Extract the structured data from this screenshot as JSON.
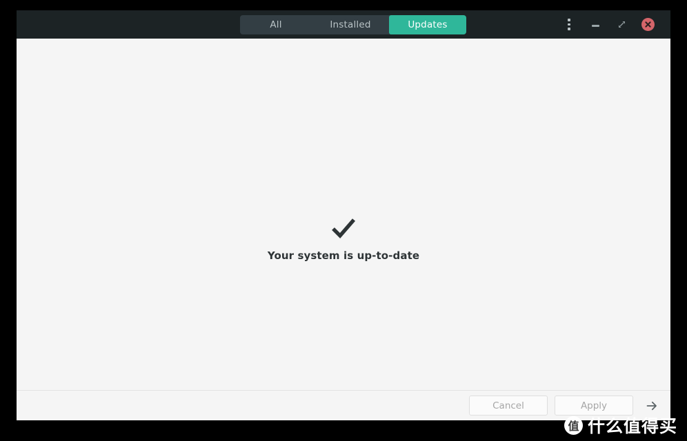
{
  "window": {
    "background_color": "#f5f5f5",
    "titlebar_color": "#1c2325"
  },
  "titlebar": {
    "tabs": [
      {
        "label": "All",
        "active": false
      },
      {
        "label": "Installed",
        "active": false
      },
      {
        "label": "Updates",
        "active": true
      }
    ],
    "active_tab_color": "#2fb79a",
    "tabgroup_color": "#333e44",
    "controls": {
      "menu_label": "⋮",
      "minimize_label": "−",
      "maximize_label": "⤡",
      "close_label": "✕",
      "close_color": "#d4656a"
    }
  },
  "main": {
    "status_icon": "check-mark",
    "status_text": "Your system is up-to-date",
    "status_text_color": "#2e3436"
  },
  "footer": {
    "cancel_label": "Cancel",
    "apply_label": "Apply",
    "next_label": "→",
    "disabled_text_color": "#a6a6a6"
  },
  "watermark": {
    "logo_text": "值",
    "text": "什么值得买"
  }
}
